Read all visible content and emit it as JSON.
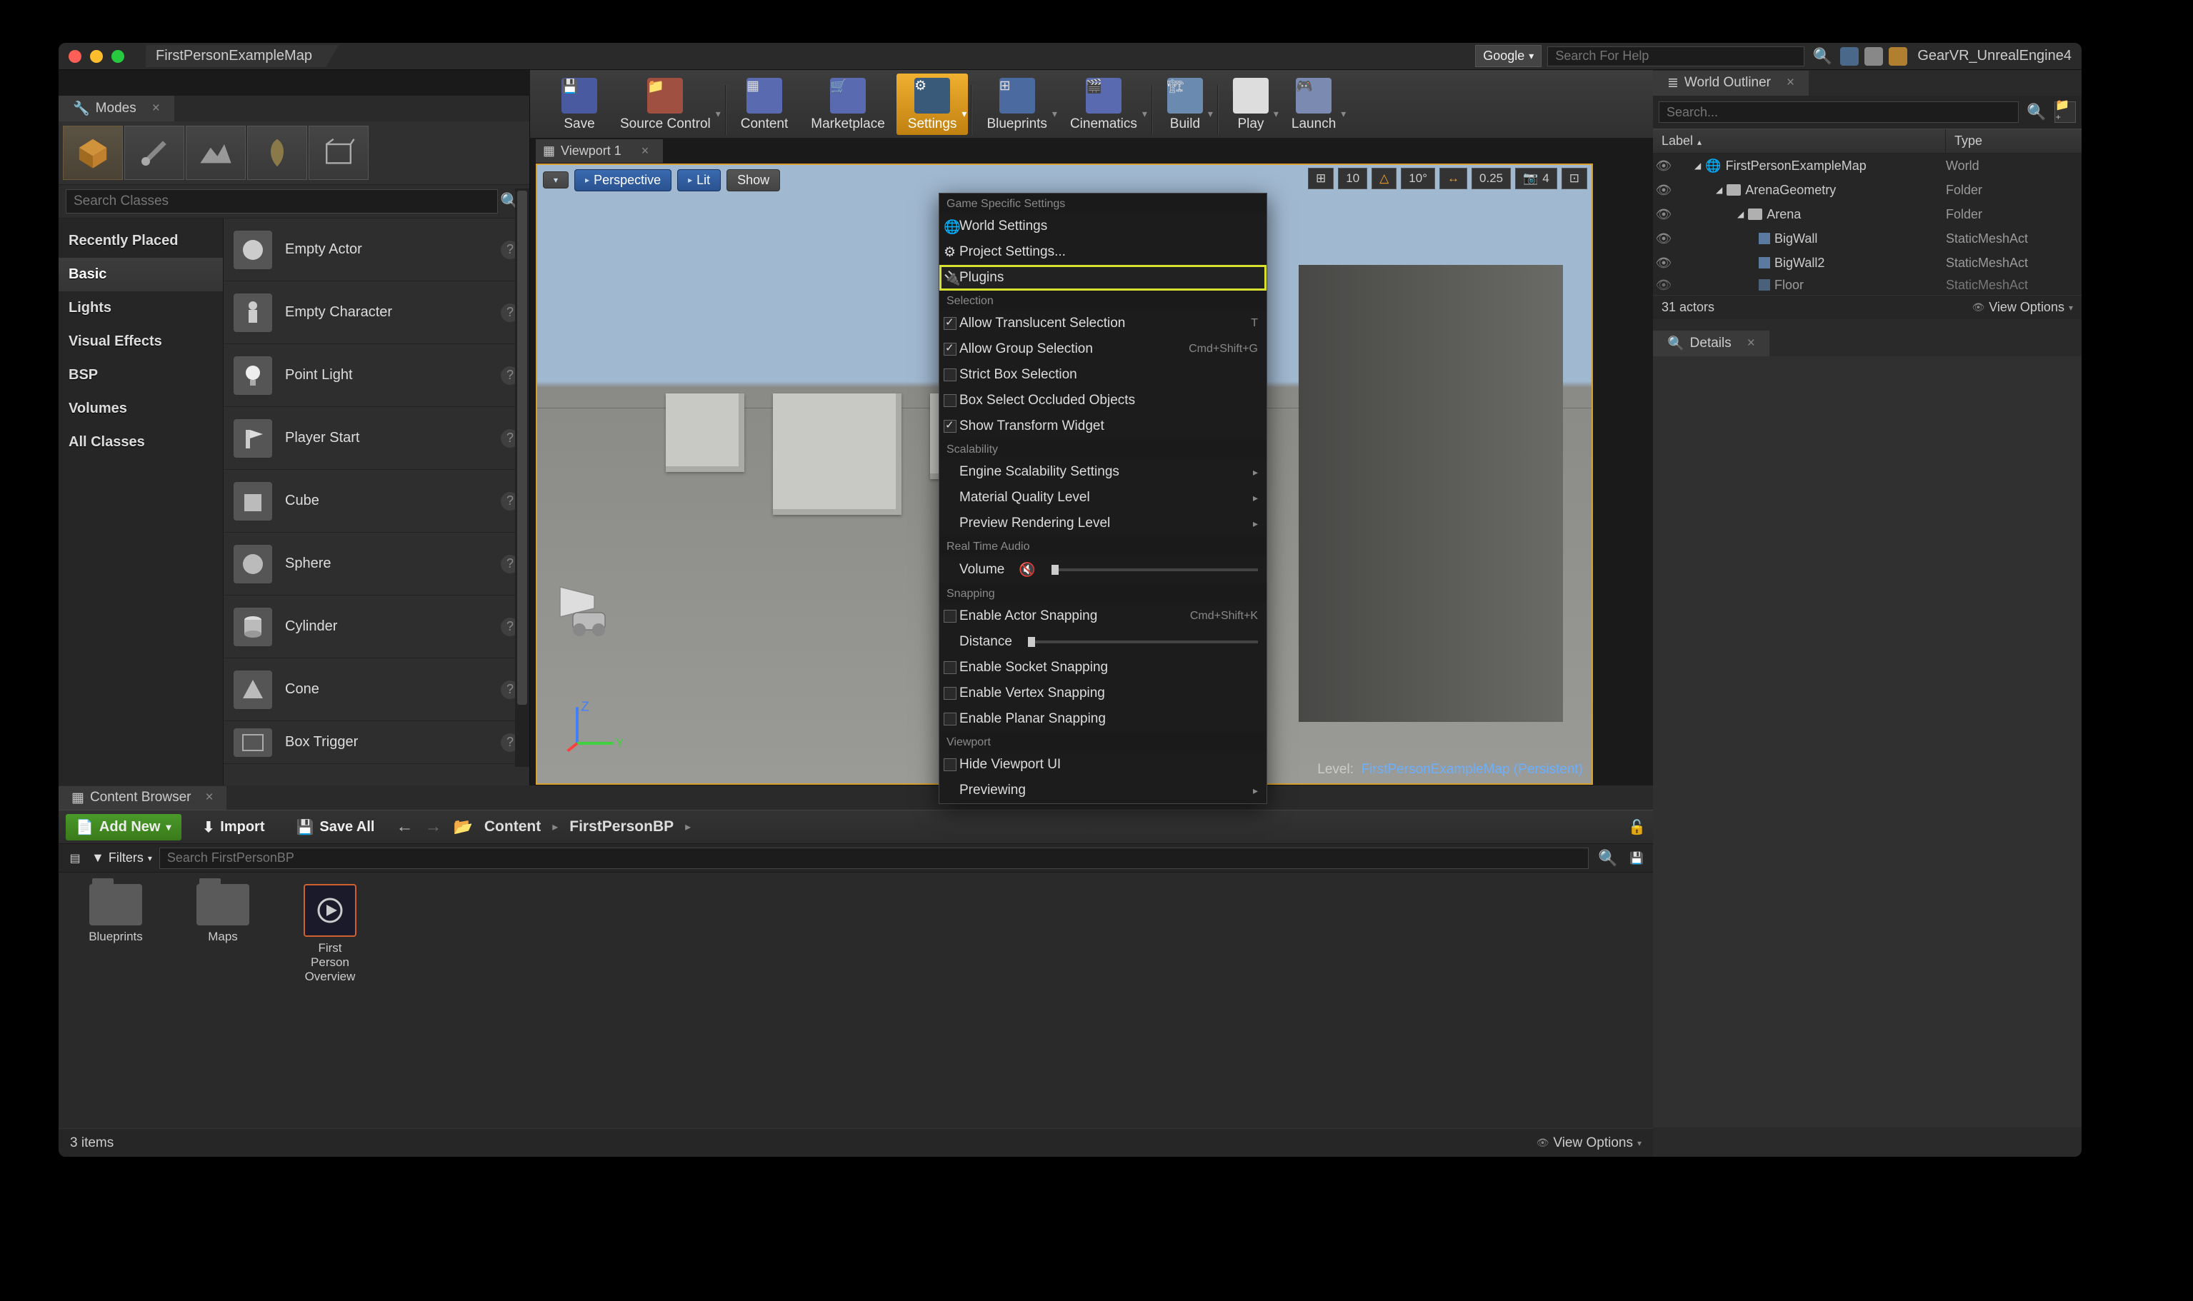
{
  "titlebar": {
    "title": "FirstPersonExampleMap",
    "google": "Google",
    "search_ph": "Search For Help",
    "project": "GearVR_UnrealEngine4"
  },
  "modes_panel": {
    "title": "Modes",
    "search_ph": "Search Classes",
    "categories": [
      "Recently Placed",
      "Basic",
      "Lights",
      "Visual Effects",
      "BSP",
      "Volumes",
      "All Classes"
    ],
    "selected_category": "Basic",
    "placeables": [
      "Empty Actor",
      "Empty Character",
      "Point Light",
      "Player Start",
      "Cube",
      "Sphere",
      "Cylinder",
      "Cone",
      "Box Trigger"
    ]
  },
  "toolbar": {
    "save": "Save",
    "source_control": "Source Control",
    "content": "Content",
    "marketplace": "Marketplace",
    "settings": "Settings",
    "blueprints": "Blueprints",
    "cinematics": "Cinematics",
    "build": "Build",
    "play": "Play",
    "launch": "Launch"
  },
  "viewport": {
    "tab": "Viewport 1",
    "perspective": "Perspective",
    "lit": "Lit",
    "show": "Show",
    "snap_grid": "10",
    "snap_angle": "10°",
    "snap_scale": "0.25",
    "cam_speed": "4",
    "level_label": "Level:",
    "level_name": "FirstPersonExampleMap (Persistent)",
    "axis_z": "Z",
    "axis_y": "Y"
  },
  "settings_menu": {
    "h_game": "Game Specific Settings",
    "world_settings": "World Settings",
    "project_settings": "Project Settings...",
    "plugins": "Plugins",
    "h_sel": "Selection",
    "allow_translucent": "Allow Translucent Selection",
    "sc_t": "T",
    "allow_group": "Allow Group Selection",
    "sc_group": "Cmd+Shift+G",
    "strict_box": "Strict Box Selection",
    "box_occluded": "Box Select Occluded Objects",
    "show_transform": "Show Transform Widget",
    "h_scal": "Scalability",
    "engine_scal": "Engine Scalability Settings",
    "mat_quality": "Material Quality Level",
    "preview_render": "Preview Rendering Level",
    "h_audio": "Real Time Audio",
    "volume": "Volume",
    "h_snap": "Snapping",
    "actor_snap": "Enable Actor Snapping",
    "sc_snap": "Cmd+Shift+K",
    "distance": "Distance",
    "socket_snap": "Enable Socket Snapping",
    "vertex_snap": "Enable Vertex Snapping",
    "planar_snap": "Enable Planar Snapping",
    "h_vp": "Viewport",
    "hide_vp_ui": "Hide Viewport UI",
    "previewing": "Previewing"
  },
  "outliner": {
    "title": "World Outliner",
    "search_ph": "Search...",
    "label": "Label",
    "type": "Type",
    "rows": [
      {
        "name": "FirstPersonExampleMap",
        "type": "World",
        "indent": 1,
        "icon": "world"
      },
      {
        "name": "ArenaGeometry",
        "type": "Folder",
        "indent": 2,
        "icon": "folder"
      },
      {
        "name": "Arena",
        "type": "Folder",
        "indent": 3,
        "icon": "folder"
      },
      {
        "name": "BigWall",
        "type": "StaticMeshAct",
        "indent": 4,
        "icon": "mesh"
      },
      {
        "name": "BigWall2",
        "type": "StaticMeshAct",
        "indent": 4,
        "icon": "mesh"
      },
      {
        "name": "Floor",
        "type": "StaticMeshAct",
        "indent": 4,
        "icon": "mesh"
      }
    ],
    "count": "31 actors",
    "view_options": "View Options"
  },
  "details": {
    "title": "Details"
  },
  "content_browser": {
    "title": "Content Browser",
    "add_new": "Add New",
    "import": "Import",
    "save_all": "Save All",
    "crumb1": "Content",
    "crumb2": "FirstPersonBP",
    "filters": "Filters",
    "search_ph": "Search FirstPersonBP",
    "items": [
      {
        "name": "Blueprints",
        "kind": "folder"
      },
      {
        "name": "Maps",
        "kind": "folder"
      },
      {
        "name": "First\nPerson\nOverview",
        "kind": "asset"
      }
    ],
    "count": "3 items",
    "view_options": "View Options"
  }
}
